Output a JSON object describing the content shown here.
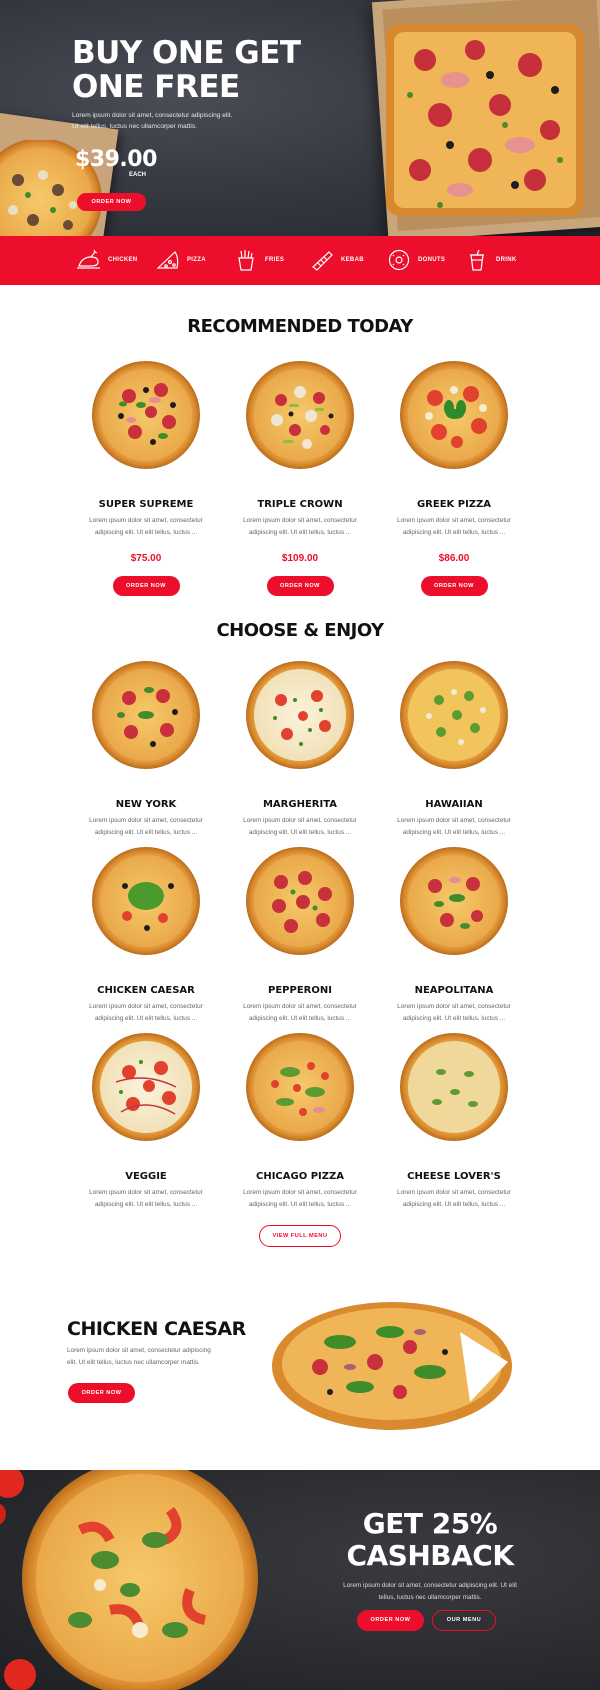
{
  "hero": {
    "title_line1": "BUY ONE GET",
    "title_line2": "ONE FREE",
    "desc_line1": "Lorem ipsum dolor sit amet, consectetur adipiscing elit.",
    "desc_line2": "Ut elit tellus, luctus nec ullamcorper mattis.",
    "price": "$39.00",
    "price_unit": "EACH",
    "button": "ORDER NOW"
  },
  "categories": [
    {
      "label": "CHICKEN",
      "icon": "chicken-icon"
    },
    {
      "label": "PIZZA",
      "icon": "pizza-icon"
    },
    {
      "label": "FRIES",
      "icon": "fries-icon"
    },
    {
      "label": "KEBAB",
      "icon": "kebab-icon"
    },
    {
      "label": "DONUTS",
      "icon": "donut-icon"
    },
    {
      "label": "DRINK",
      "icon": "drink-icon"
    }
  ],
  "recommended": {
    "title": "RECOMMENDED TODAY",
    "items": [
      {
        "name": "SUPER SUPREME",
        "desc1": "Lorem ipsum dolor sit amet, consectetur",
        "desc2": "adipiscing elit. Ut elit tellus, luctus ...",
        "price": "$75.00",
        "button": "ORDER NOW"
      },
      {
        "name": "TRIPLE CROWN",
        "desc1": "Lorem ipsum dolor sit amet, consectetur",
        "desc2": "adipiscing elit. Ut elit tellus, luctus ...",
        "price": "$109.00",
        "button": "ORDER NOW"
      },
      {
        "name": "GREEK PIZZA",
        "desc1": "Lorem ipsum dolor sit amet, consectetur",
        "desc2": "adipiscing elit. Ut elit tellus, luctus ...",
        "price": "$86.00",
        "button": "ORDER NOW"
      }
    ]
  },
  "menu": {
    "title": "CHOOSE & ENJOY",
    "items": [
      {
        "name": "NEW YORK",
        "desc1": "Lorem ipsum dolor sit amet, consectetur",
        "desc2": "adipiscing elit. Ut elit tellus, luctus ..."
      },
      {
        "name": "MARGHERITA",
        "desc1": "Lorem ipsum dolor sit amet, consectetur",
        "desc2": "adipiscing elit. Ut elit tellus, luctus ..."
      },
      {
        "name": "HAWAIIAN",
        "desc1": "Lorem ipsum dolor sit amet, consectetur",
        "desc2": "adipiscing elit. Ut elit tellus, luctus ..."
      },
      {
        "name": "CHICKEN CAESAR",
        "desc1": "Lorem ipsum dolor sit amet, consectetur",
        "desc2": "adipiscing elit. Ut elit tellus, luctus ..."
      },
      {
        "name": "PEPPERONI",
        "desc1": "Lorem ipsum dolor sit amet, consectetur",
        "desc2": "adipiscing elit. Ut elit tellus, luctus ..."
      },
      {
        "name": "NEAPOLITANA",
        "desc1": "Lorem ipsum dolor sit amet, consectetur",
        "desc2": "adipiscing elit. Ut elit tellus, luctus ..."
      },
      {
        "name": "VEGGIE",
        "desc1": "Lorem ipsum dolor sit amet, consectetur",
        "desc2": "adipiscing elit. Ut elit tellus, luctus ..."
      },
      {
        "name": "CHICAGO PIZZA",
        "desc1": "Lorem ipsum dolor sit amet, consectetur",
        "desc2": "adipiscing elit. Ut elit tellus, luctus ..."
      },
      {
        "name": "CHEESE LOVER'S",
        "desc1": "Lorem ipsum dolor sit amet, consectetur",
        "desc2": "adipiscing elit. Ut elit tellus, luctus ..."
      }
    ],
    "view_button": "VIEW FULL MENU"
  },
  "feature": {
    "title": "CHICKEN CAESAR",
    "desc_line1": "Lorem ipsum dolor sit amet, consectetur adipiscing",
    "desc_line2": "elit. Ut elit tellus, luctus nec ullamcorper mattis.",
    "button": "ORDER NOW"
  },
  "cashback": {
    "title_line1": "GET 25%",
    "title_line2": "CASHBACK",
    "desc_line1": "Lorem ipsum dolor sit amet, consectetur adipiscing elit. Ut elit",
    "desc_line2": "tellus, luctus nec ullamcorper mattis.",
    "button_primary": "ORDER NOW",
    "button_secondary": "OUR MENU"
  },
  "colors": {
    "accent": "#ec0e2b",
    "dark": "#2f3036"
  }
}
